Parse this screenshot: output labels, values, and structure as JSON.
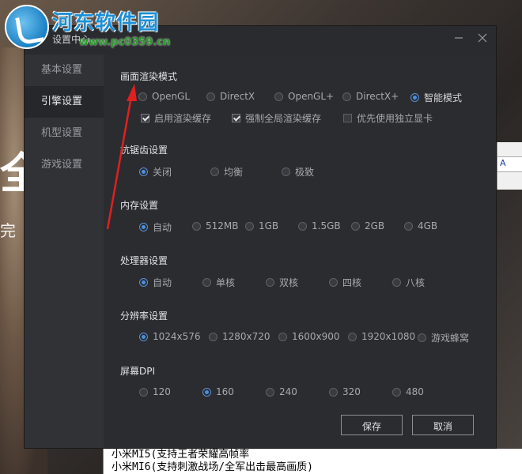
{
  "background": {
    "big_char": "全",
    "small_char": "完美",
    "window_glyph": "A",
    "list": [
      "小米MI5(支持王者荣耀高帧率",
      "小米MI6(支持刺激战场/全军出击最高画质)"
    ]
  },
  "watermark": {
    "title": "河东软件园",
    "url": "www.pc0359.cn"
  },
  "dialog": {
    "title": "设置中心",
    "minimize_icon": "minimize-icon",
    "close_icon": "close-icon"
  },
  "sidebar": {
    "items": [
      {
        "label": "基本设置",
        "active": false
      },
      {
        "label": "引擎设置",
        "active": true
      },
      {
        "label": "机型设置",
        "active": false
      },
      {
        "label": "游戏设置",
        "active": false
      }
    ]
  },
  "sections": {
    "render": {
      "title": "画面渲染模式",
      "options": [
        "OpenGL",
        "DirectX",
        "OpenGL+",
        "DirectX+",
        "智能模式"
      ],
      "selected": "智能模式",
      "checks": [
        {
          "label": "启用渲染缓存",
          "checked": true
        },
        {
          "label": "强制全局渲染缓存",
          "checked": true
        },
        {
          "label": "优先使用独立显卡",
          "checked": false
        }
      ]
    },
    "antialias": {
      "title": "抗锯齿设置",
      "options": [
        "关闭",
        "均衡",
        "极致"
      ],
      "selected": "关闭"
    },
    "memory": {
      "title": "内存设置",
      "options": [
        "自动",
        "512MB",
        "1GB",
        "1.5GB",
        "2GB",
        "4GB"
      ],
      "selected": "自动"
    },
    "cpu": {
      "title": "处理器设置",
      "options": [
        "自动",
        "单核",
        "双核",
        "四核",
        "八核"
      ],
      "selected": "自动"
    },
    "resolution": {
      "title": "分辨率设置",
      "options": [
        "1024x576",
        "1280x720",
        "1600x900",
        "1920x1080",
        "游戏蜂窝"
      ],
      "selected": "1024x576"
    },
    "dpi": {
      "title": "屏幕DPI",
      "options": [
        "120",
        "160",
        "240",
        "320",
        "480"
      ],
      "selected": "160"
    }
  },
  "buttons": {
    "save": "保存",
    "cancel": "取消"
  },
  "colors": {
    "accent": "#4a90e2",
    "annotation_arrow": "#e02020"
  }
}
